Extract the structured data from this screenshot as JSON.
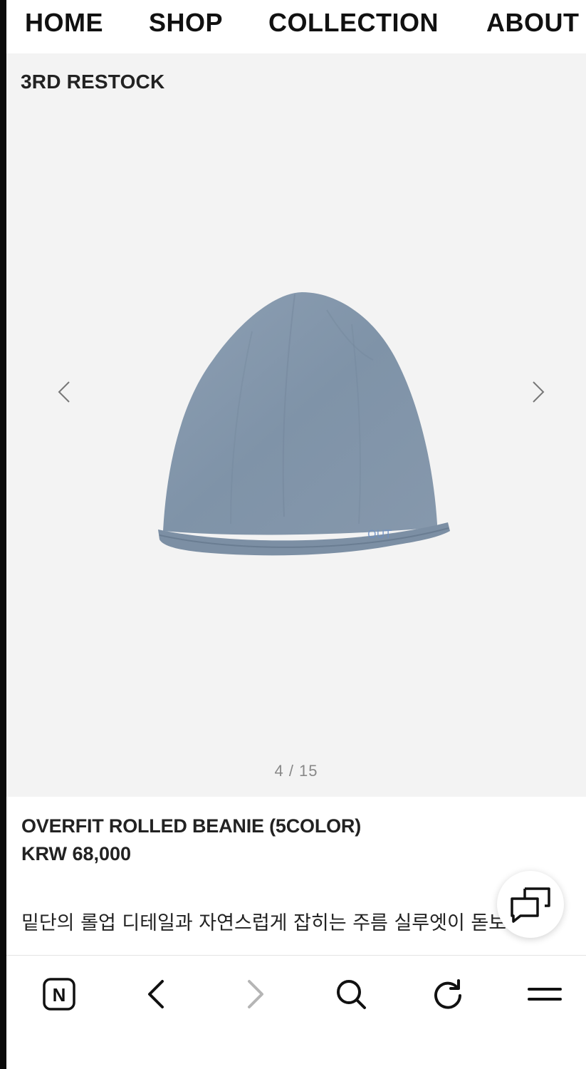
{
  "nav": {
    "items": [
      {
        "label": "HOME"
      },
      {
        "label": "SHOP"
      },
      {
        "label": "COLLECTION"
      },
      {
        "label": "ABOUT"
      }
    ]
  },
  "gallery": {
    "title": "3RD RESTOCK",
    "counter": "4 / 15",
    "image": "grey-rolled-beanie",
    "prev_icon": "chevron-left-icon",
    "next_icon": "chevron-right-icon"
  },
  "product": {
    "name": "OVERFIT ROLLED BEANIE (5COLOR)",
    "price": "KRW 68,000",
    "description": "밑단의 롤업 디테일과 자연스럽게 잡히는 주름 실루엣이 돋보이는 비니입니다"
  },
  "chat": {
    "icon": "chat-bubbles-icon"
  },
  "toolbar": {
    "items": [
      {
        "icon": "naver-n-icon",
        "label": "N"
      },
      {
        "icon": "back-arrow-icon"
      },
      {
        "icon": "forward-arrow-icon"
      },
      {
        "icon": "search-icon"
      },
      {
        "icon": "reload-icon"
      },
      {
        "icon": "menu-icon"
      }
    ]
  },
  "colors": {
    "text": "#111111",
    "gallery_bg": "#f3f3f3",
    "counter": "#888888",
    "beanie": "#8a9cb0",
    "forward_disabled": "#b5b5b5"
  }
}
